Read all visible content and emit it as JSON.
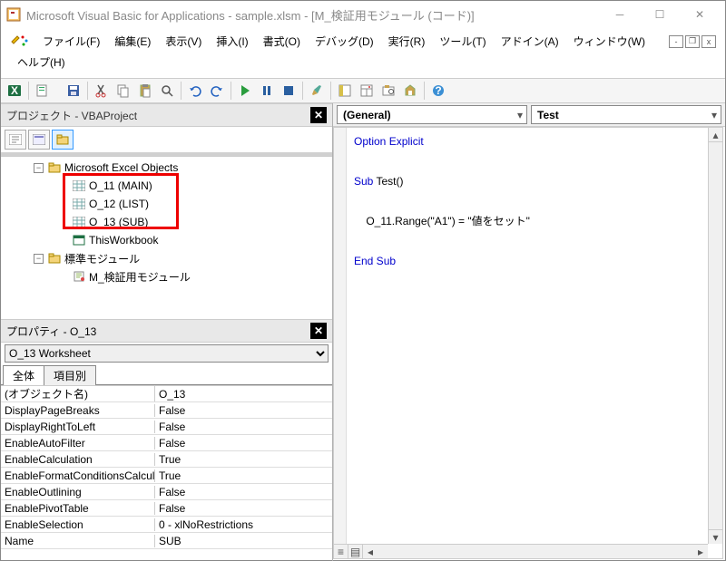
{
  "title": "Microsoft Visual Basic for Applications - sample.xlsm - [M_検証用モジュール (コード)]",
  "menu": {
    "file": "ファイル(F)",
    "edit": "編集(E)",
    "view": "表示(V)",
    "insert": "挿入(I)",
    "format": "書式(O)",
    "debug": "デバッグ(D)",
    "run": "実行(R)",
    "tools": "ツール(T)",
    "addins": "アドイン(A)",
    "window": "ウィンドウ(W)",
    "help": "ヘルプ(H)"
  },
  "project_pane": {
    "title": "プロジェクト - VBAProject",
    "folder1": "Microsoft Excel Objects",
    "items": [
      "O_11 (MAIN)",
      "O_12 (LIST)",
      "O_13 (SUB)"
    ],
    "thiswb": "ThisWorkbook",
    "folder2": "標準モジュール",
    "module": "M_検証用モジュール"
  },
  "prop_pane": {
    "title": "プロパティ - O_13",
    "selector": "O_13 Worksheet",
    "tab_all": "全体",
    "tab_cat": "項目別",
    "rows": [
      [
        "(オブジェクト名)",
        "O_13"
      ],
      [
        "DisplayPageBreaks",
        "False"
      ],
      [
        "DisplayRightToLeft",
        "False"
      ],
      [
        "EnableAutoFilter",
        "False"
      ],
      [
        "EnableCalculation",
        "True"
      ],
      [
        "EnableFormatConditionsCalculation",
        "True"
      ],
      [
        "EnableOutlining",
        "False"
      ],
      [
        "EnablePivotTable",
        "False"
      ],
      [
        "EnableSelection",
        "0 - xlNoRestrictions"
      ],
      [
        "Name",
        "SUB"
      ]
    ]
  },
  "code": {
    "obj": "(General)",
    "proc": "Test",
    "l1": "Option Explicit",
    "l2a": "Sub",
    "l2b": " Test()",
    "l3": "    O_11.Range(\"A1\") = \"値をセット\"",
    "l4": "End Sub"
  }
}
